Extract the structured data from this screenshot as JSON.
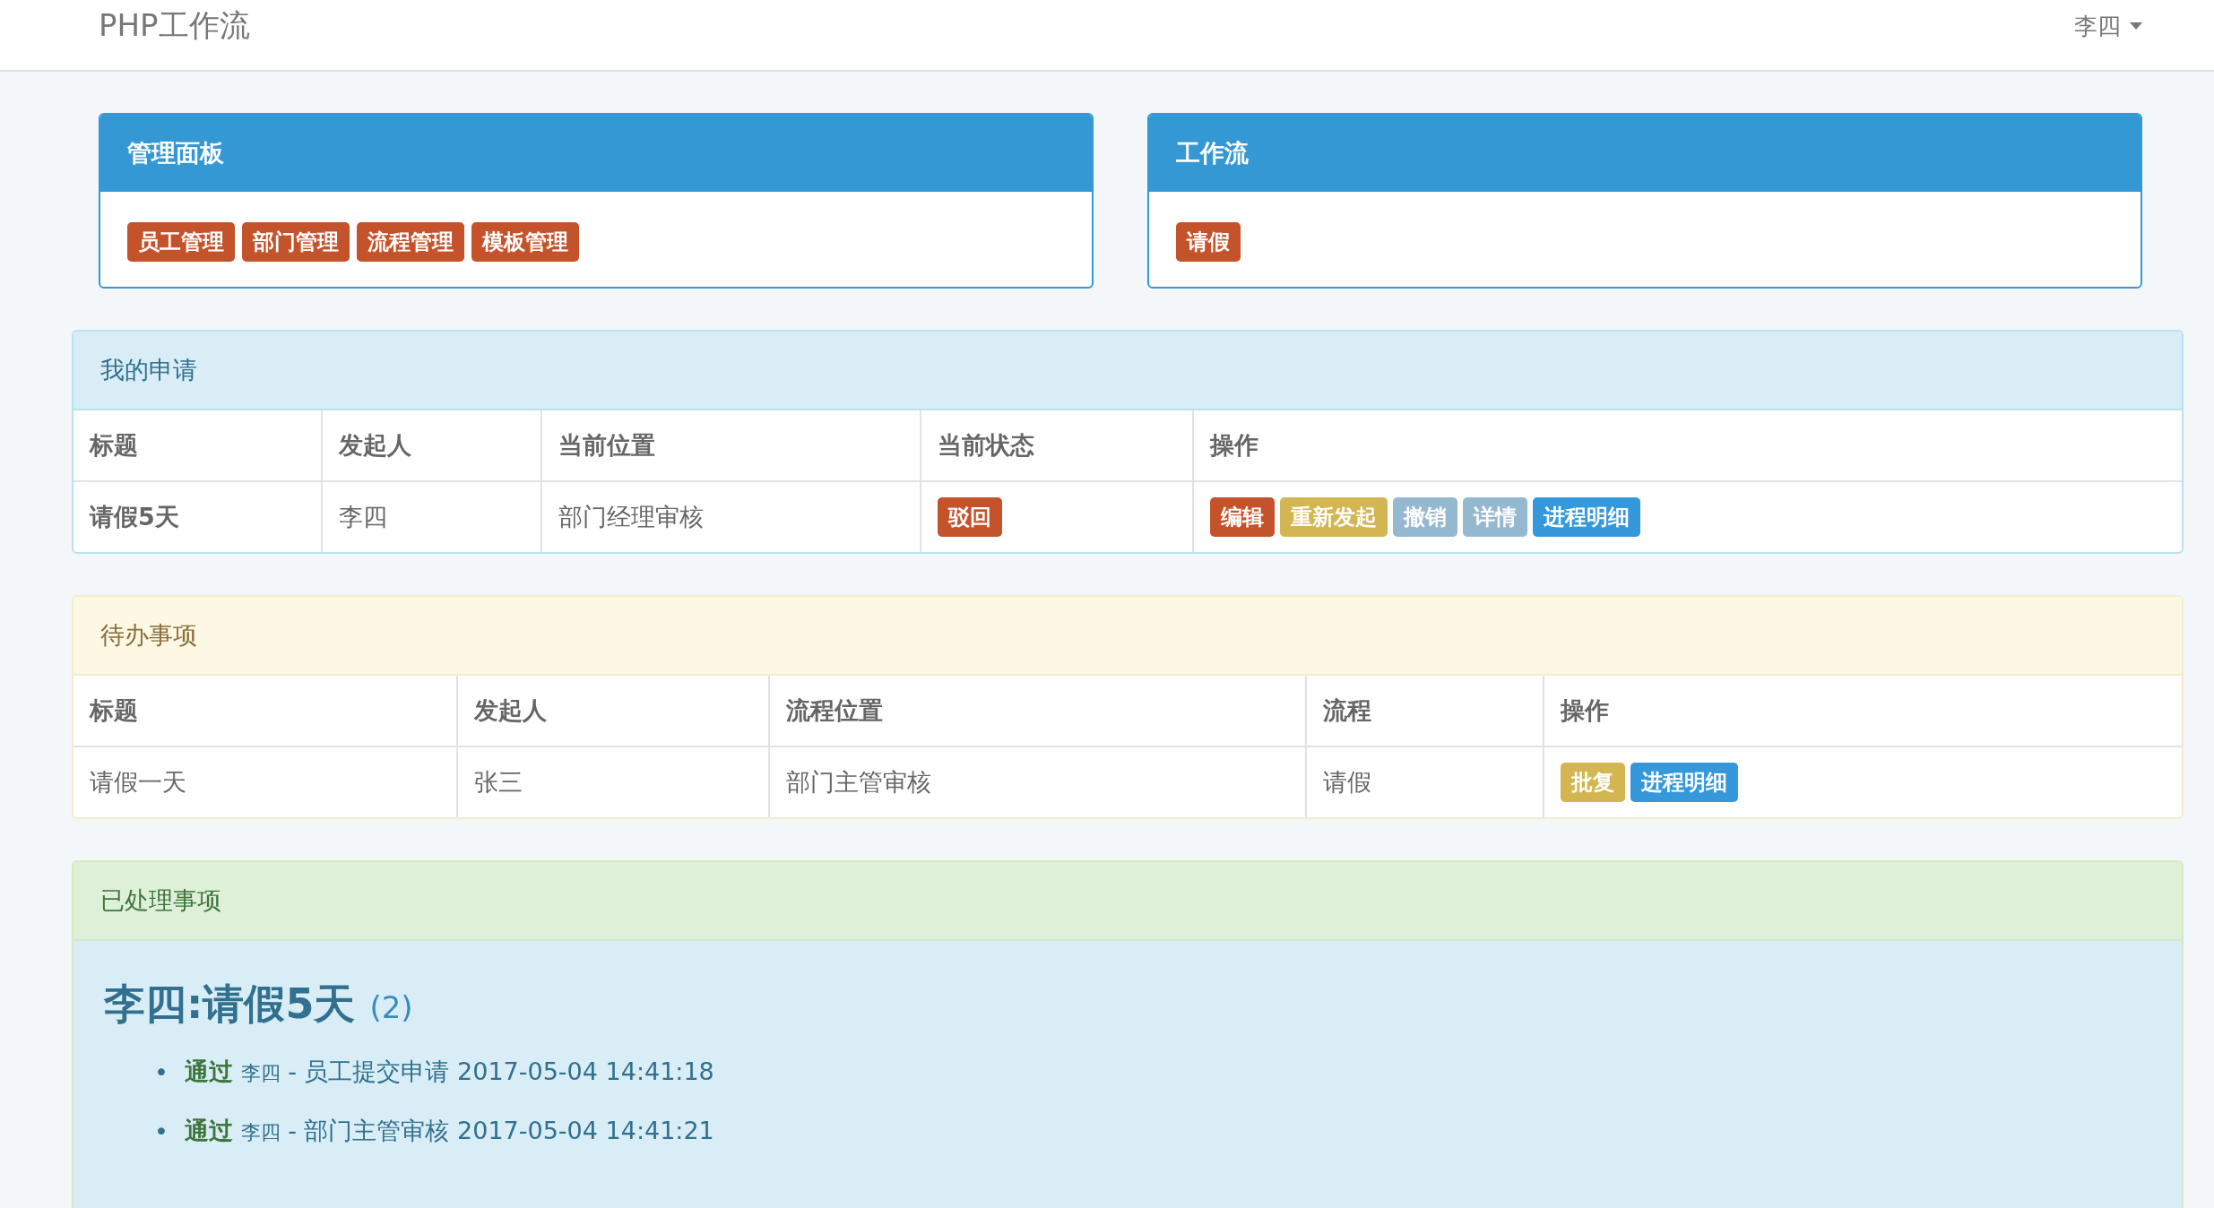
{
  "navbar": {
    "brand": "PHP工作流",
    "user_menu": "李四"
  },
  "admin_panel": {
    "title": "管理面板",
    "links": [
      {
        "label": "员工管理",
        "kind": "danger"
      },
      {
        "label": "部门管理",
        "kind": "danger"
      },
      {
        "label": "流程管理",
        "kind": "danger"
      },
      {
        "label": "模板管理",
        "kind": "danger"
      }
    ]
  },
  "workflow_panel": {
    "title": "工作流",
    "links": [
      {
        "label": "请假",
        "kind": "danger"
      }
    ]
  },
  "my_requests": {
    "title": "我的申请",
    "columns": [
      "标题",
      "发起人",
      "当前位置",
      "当前状态",
      "操作"
    ],
    "rows": [
      {
        "title": "请假5天",
        "initiator": "李四",
        "position": "部门经理审核",
        "status": {
          "label": "驳回",
          "kind": "danger"
        },
        "actions": [
          {
            "label": "编辑",
            "kind": "danger"
          },
          {
            "label": "重新发起",
            "kind": "warning"
          },
          {
            "label": "撤销",
            "kind": "muted"
          },
          {
            "label": "详情",
            "kind": "muted"
          },
          {
            "label": "进程明细",
            "kind": "primary"
          }
        ]
      }
    ]
  },
  "todo": {
    "title": "待办事项",
    "columns": [
      "标题",
      "发起人",
      "流程位置",
      "流程",
      "操作"
    ],
    "rows": [
      {
        "title": "请假一天",
        "initiator": "张三",
        "position": "部门主管审核",
        "flow": "请假",
        "actions": [
          {
            "label": "批复",
            "kind": "warning"
          },
          {
            "label": "进程明细",
            "kind": "primary"
          }
        ]
      }
    ]
  },
  "processed": {
    "title": "已处理事项",
    "items": [
      {
        "heading": "李四:请假5天",
        "count": "(2)",
        "steps": [
          {
            "bullet": "•",
            "result": "通过",
            "user": "李四",
            "text": "- 员工提交申请 2017-05-04 14:41:18"
          },
          {
            "bullet": "•",
            "result": "通过",
            "user": "李四",
            "text": "- 部门主管审核 2017-05-04 14:41:21"
          }
        ]
      }
    ]
  }
}
